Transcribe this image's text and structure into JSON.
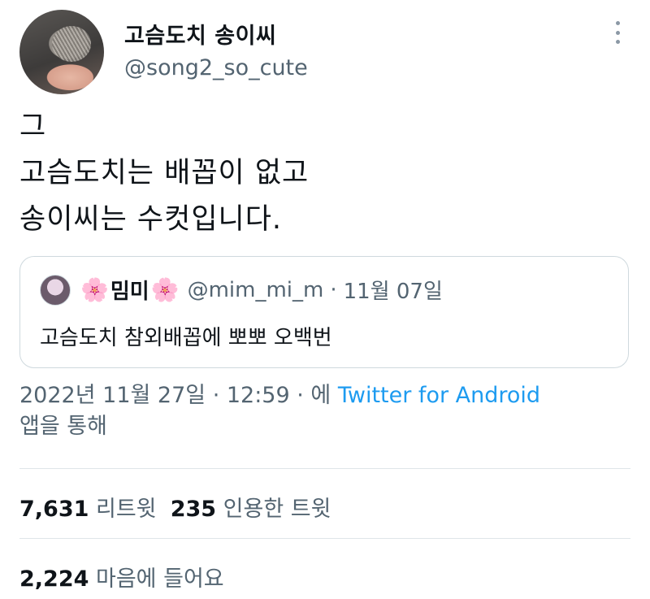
{
  "author": {
    "display_name": "고슴도치 송이씨",
    "handle": "@song2_so_cute"
  },
  "tweet": {
    "lines": [
      "그",
      "고슴도치는 배꼽이 없고",
      "송이씨는 수컷입니다."
    ]
  },
  "quoted_tweet": {
    "name": "밈미",
    "name_emoji": "🌸",
    "handle": "@mim_mi_m",
    "separator": "·",
    "date": "11월 07일",
    "text": "고슴도치 참외배꼽에 뽀뽀 오백번"
  },
  "meta": {
    "datetime": "2022년 11월 27일 · 12:59 · 에",
    "source": "Twitter for Android",
    "via": "앱을 통해"
  },
  "stats": {
    "retweets_count": "7,631",
    "retweets_label": "리트윗",
    "quotes_count": "235",
    "quotes_label": "인용한 트윗",
    "likes_count": "2,224",
    "likes_label": "마음에 들어요"
  },
  "icons": {
    "more": "more-vertical-icon",
    "blossom": "cherry-blossom-icon"
  },
  "colors": {
    "text": "#0f1419",
    "secondary": "#536471",
    "link": "#1d9bf0",
    "border": "#cfd9de"
  }
}
